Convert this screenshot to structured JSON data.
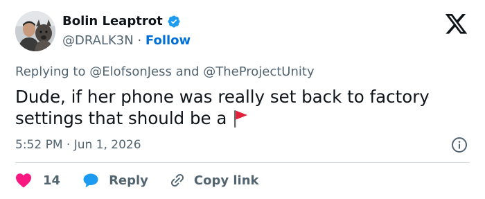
{
  "author": {
    "display_name": "Bolin Leaptrot",
    "handle": "@DRALK3N",
    "separator": "·",
    "follow_label": "Follow",
    "avatar_icon": "avatar-photo"
  },
  "brand": {
    "icon": "x-logo-icon",
    "color": "#0f1419"
  },
  "reply_to": {
    "prefix": "Replying to",
    "mention1": "@ElofsonJess",
    "conjunction": "and",
    "mention2": "@TheProjectUnity"
  },
  "tweet": {
    "text": "Dude, if her phone was really set back to factory settings that should be a",
    "emoji_icon": "red-flag-icon"
  },
  "timestamp": "5:52 PM · Jun 1, 2026",
  "actions": {
    "like_count": "14",
    "reply_label": "Reply",
    "copy_link_label": "Copy link"
  },
  "colors": {
    "accent": "#006fd6",
    "verified": "#1d9bf0",
    "like": "#f91880",
    "reply": "#1d9bf0",
    "muted": "#536471"
  }
}
